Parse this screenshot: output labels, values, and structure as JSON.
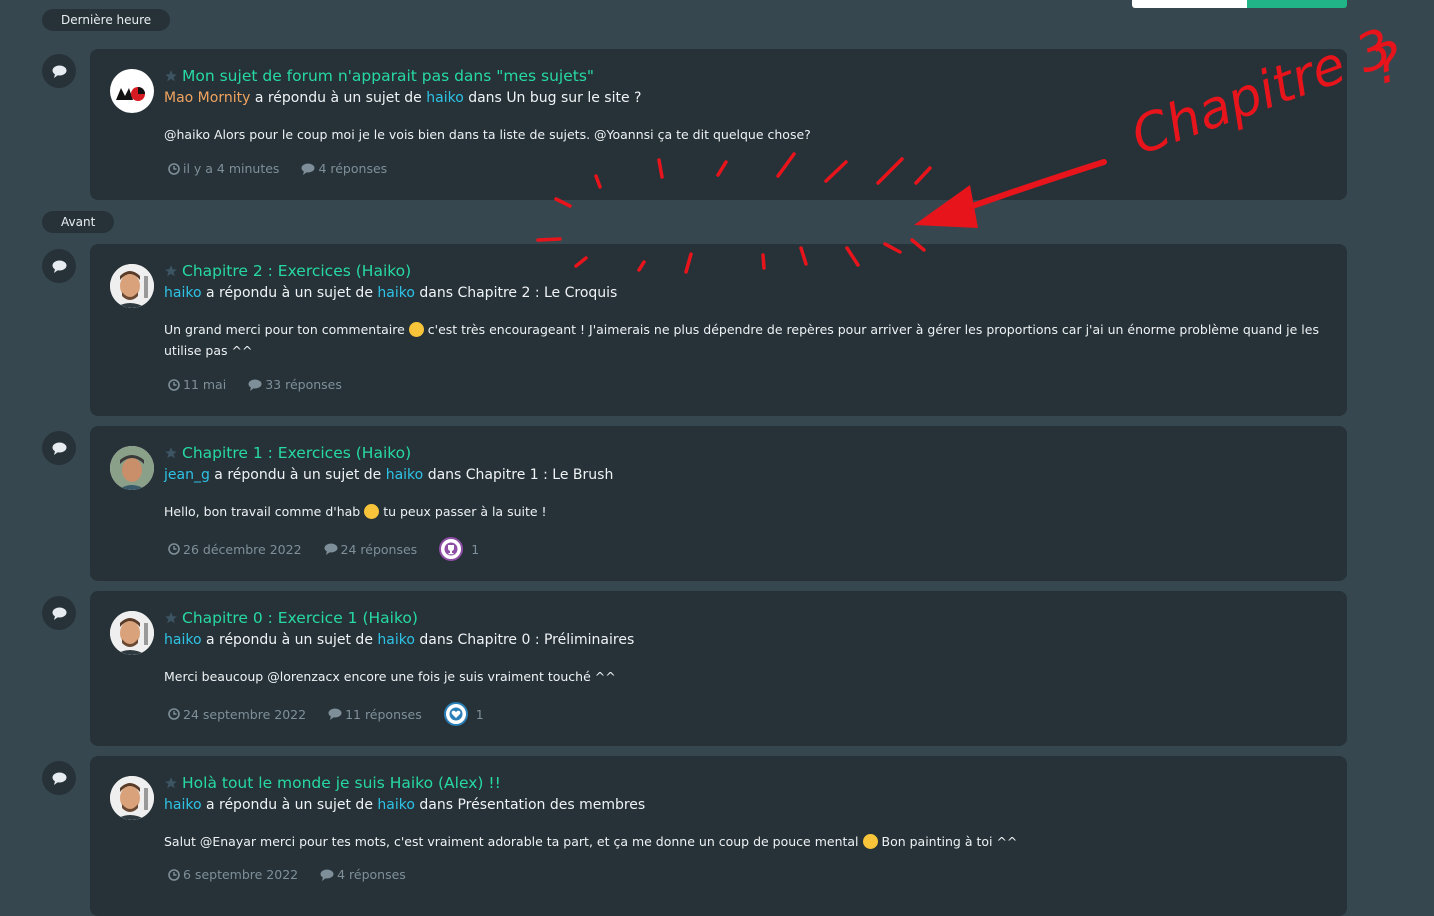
{
  "separators": {
    "recent": "Dernière heure",
    "before": "Avant"
  },
  "annotation": {
    "text": "Chapitre 3",
    "mark": "?",
    "color": "#e8141c"
  },
  "items": [
    {
      "title": "Mon sujet de forum n'apparait pas dans \"mes sujets\"",
      "author": "Mao Mornity",
      "verb": "a répondu à un sujet de",
      "owner": "haiko",
      "in": "dans",
      "forum": "Un bug sur le site ?",
      "snippet": "@haiko Alors pour le coup moi je le vois bien dans ta liste de sujets. @Yoannsi ça te dit quelque chose?",
      "time": "il y a 4 minutes",
      "replies": "4 réponses"
    },
    {
      "title": "Chapitre 2 : Exercices (Haiko)",
      "author": "haiko",
      "verb": "a répondu à un sujet de",
      "owner": "haiko",
      "in": "dans",
      "forum": "Chapitre 2 : Le Croquis",
      "snippet_a": "Un grand merci pour ton commentaire",
      "snippet_b": "c'est très encourageant ! J'aimerais ne plus dépendre de repères pour arriver à gérer les proportions car j'ai un énorme problème quand je les utilise pas ^^",
      "time": "11 mai",
      "replies": "33 réponses"
    },
    {
      "title": "Chapitre 1 : Exercices (Haiko)",
      "author": "jean_g",
      "verb": "a répondu à un sujet de",
      "owner": "haiko",
      "in": "dans",
      "forum": "Chapitre 1 : Le Brush",
      "snippet_a": "Hello, bon travail comme d'hab",
      "snippet_b": "tu peux passer à la suite !",
      "time": "26 décembre 2022",
      "replies": "24 réponses",
      "reaction_count": "1",
      "reaction_icon": "trophy-icon"
    },
    {
      "title": "Chapitre 0 : Exercice 1 (Haiko)",
      "author": "haiko",
      "verb": "a répondu à un sujet de",
      "owner": "haiko",
      "in": "dans",
      "forum": "Chapitre 0 : Préliminaires",
      "snippet": "Merci beaucoup @lorenzacx encore une fois je suis vraiment touché ^^",
      "time": "24 septembre 2022",
      "replies": "11 réponses",
      "reaction_count": "1",
      "reaction_icon": "heart-icon"
    },
    {
      "title": "Holà tout le monde je suis Haiko (Alex) !!",
      "author": "haiko",
      "verb": "a répondu à un sujet de",
      "owner": "haiko",
      "in": "dans",
      "forum": "Présentation des membres",
      "snippet_a": "Salut @Enayar merci pour tes mots, c'est vraiment adorable ta part, et ça me donne un coup de pouce mental",
      "snippet_b": "Bon painting à toi ^^",
      "time": "6 septembre 2022",
      "replies": "4 réponses"
    }
  ],
  "colors": {
    "background": "#37474f",
    "card": "#263238",
    "title": "#26d9a3",
    "user": "#2ec3e6",
    "meta": "#7f8f99"
  }
}
